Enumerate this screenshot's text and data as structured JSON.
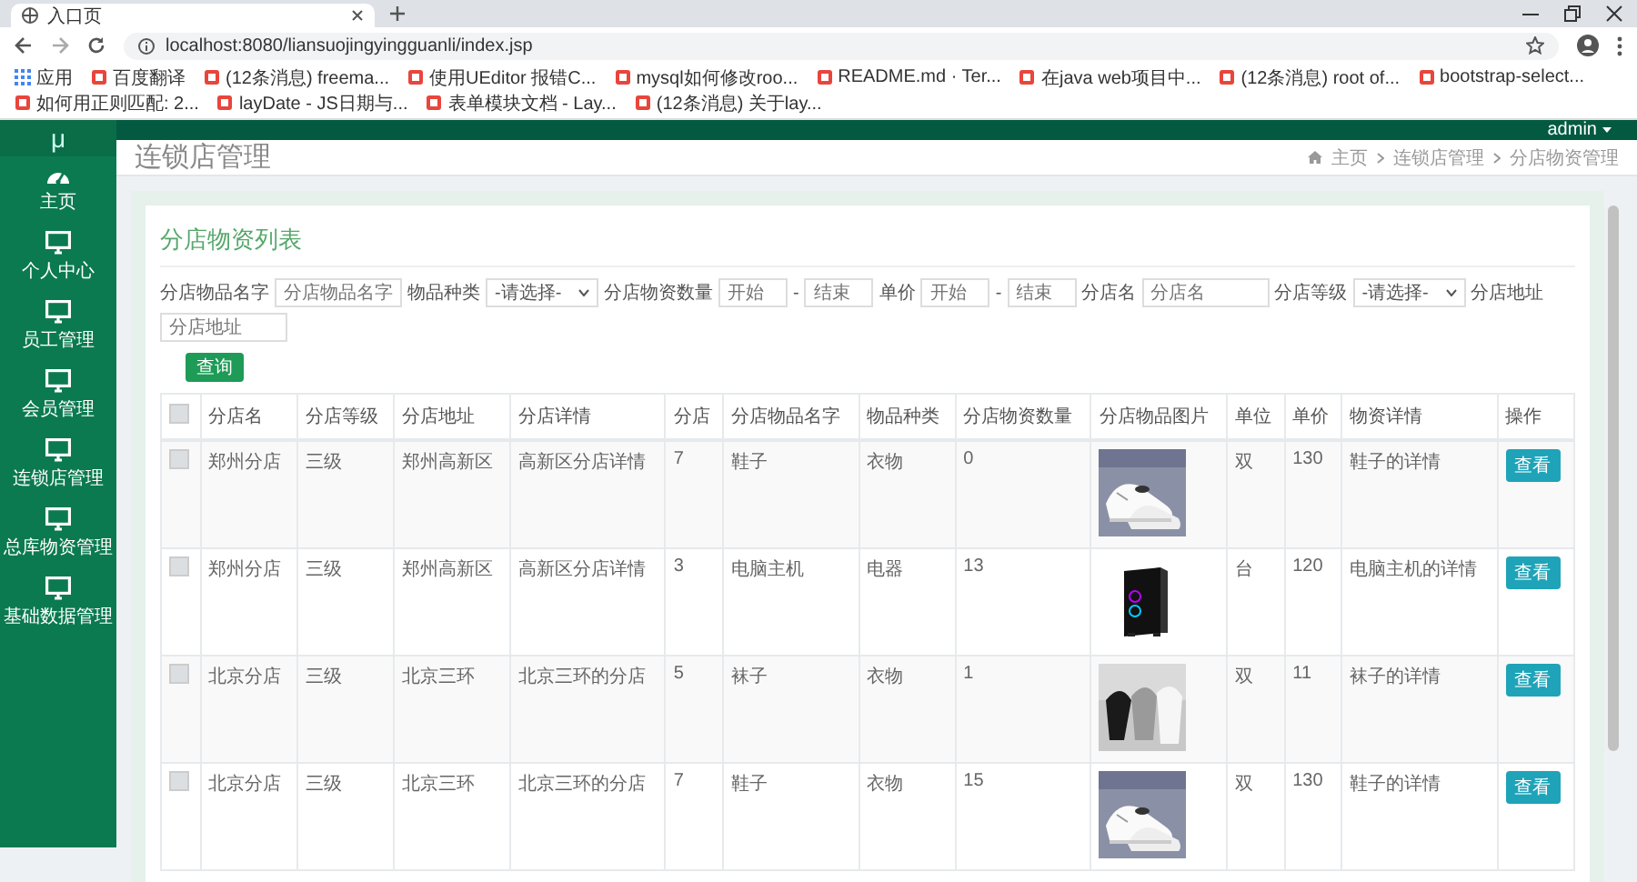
{
  "browser": {
    "tab_title": "入口页",
    "url": "localhost:8080/liansuojingyingguanli/index.jsp",
    "bookmarks": [
      {
        "label": "应用",
        "kind": "apps"
      },
      {
        "label": "百度翻译",
        "kind": "page"
      },
      {
        "label": "(12条消息) freema...",
        "kind": "page"
      },
      {
        "label": "使用UEditor 报错C...",
        "kind": "page"
      },
      {
        "label": "mysql如何修改roo...",
        "kind": "page"
      },
      {
        "label": "README.md · Ter...",
        "kind": "page"
      },
      {
        "label": "在java web项目中...",
        "kind": "page"
      },
      {
        "label": "(12条消息) root of...",
        "kind": "page"
      },
      {
        "label": "bootstrap-select...",
        "kind": "page"
      },
      {
        "label": "如何用正则匹配: 2...",
        "kind": "page"
      },
      {
        "label": "layDate - JS日期与...",
        "kind": "page"
      },
      {
        "label": "表单模块文档 - Lay...",
        "kind": "page"
      },
      {
        "label": "(12条消息) 关于lay...",
        "kind": "page"
      }
    ]
  },
  "header": {
    "logo": "μ",
    "user": "admin"
  },
  "sidebar": {
    "items": [
      {
        "label": "主页",
        "kind": "dashboard"
      },
      {
        "label": "个人中心",
        "kind": "monitor"
      },
      {
        "label": "员工管理",
        "kind": "monitor"
      },
      {
        "label": "会员管理",
        "kind": "monitor"
      },
      {
        "label": "连锁店管理",
        "kind": "monitor"
      },
      {
        "label": "总库物资管理",
        "kind": "monitor"
      },
      {
        "label": "基础数据管理",
        "kind": "monitor"
      }
    ]
  },
  "page_title": "连锁店管理",
  "breadcrumbs": [
    "主页",
    "连锁店管理",
    "分店物资管理"
  ],
  "list_title": "分店物资列表",
  "filters": [
    {
      "kind": "text",
      "label": "分店物品名字",
      "placeholder": "分店物品名字"
    },
    {
      "kind": "select",
      "label": "物品种类",
      "value": "-请选择-"
    },
    {
      "kind": "range",
      "label": "分店物资数量",
      "from_placeholder": "开始",
      "separator": "-",
      "to_placeholder": "结束"
    },
    {
      "kind": "range",
      "label": "单价",
      "from_placeholder": "开始",
      "separator": "-",
      "to_placeholder": "结束"
    },
    {
      "kind": "text",
      "label": "分店名",
      "placeholder": "分店名"
    },
    {
      "kind": "select",
      "label": "分店等级",
      "value": "-请选择-"
    },
    {
      "kind": "text",
      "label": "分店地址",
      "placeholder": "分店地址"
    }
  ],
  "query_button": "查询",
  "table": {
    "select_all_checked": false,
    "columns": [
      "分店名",
      "分店等级",
      "分店地址",
      "分店详情",
      "分店",
      "分店物品名字",
      "物品种类",
      "分店物资数量",
      "分店物品图片",
      "单位",
      "单价",
      "物资详情",
      "操作"
    ],
    "rows": [
      {
        "checked": false,
        "cells": [
          "郑州分店",
          "三级",
          "郑州高新区",
          "高新区分店详情",
          "7",
          "鞋子",
          "衣物",
          "0"
        ],
        "picture": {
          "kind": "picture"
        },
        "cells_after": [
          "双",
          "130",
          "鞋子的详情"
        ],
        "action": "查看"
      },
      {
        "checked": false,
        "cells": [
          "郑州分店",
          "三级",
          "郑州高新区",
          "高新区分店详情",
          "3",
          "电脑主机",
          "电器",
          "13"
        ],
        "picture": {
          "kind": "picture"
        },
        "cells_after": [
          "台",
          "120",
          "电脑主机的详情"
        ],
        "action": "查看"
      },
      {
        "checked": false,
        "cells": [
          "北京分店",
          "三级",
          "北京三环",
          "北京三环的分店",
          "5",
          "袜子",
          "衣物",
          "1"
        ],
        "picture": {
          "kind": "picture"
        },
        "cells_after": [
          "双",
          "11",
          "袜子的详情"
        ],
        "action": "查看"
      },
      {
        "checked": false,
        "cells": [
          "北京分店",
          "三级",
          "北京三环",
          "北京三环的分店",
          "7",
          "鞋子",
          "衣物",
          "15"
        ],
        "picture": {
          "kind": "picture"
        },
        "cells_after": [
          "双",
          "130",
          "鞋子的详情"
        ],
        "action": "查看"
      }
    ]
  }
}
